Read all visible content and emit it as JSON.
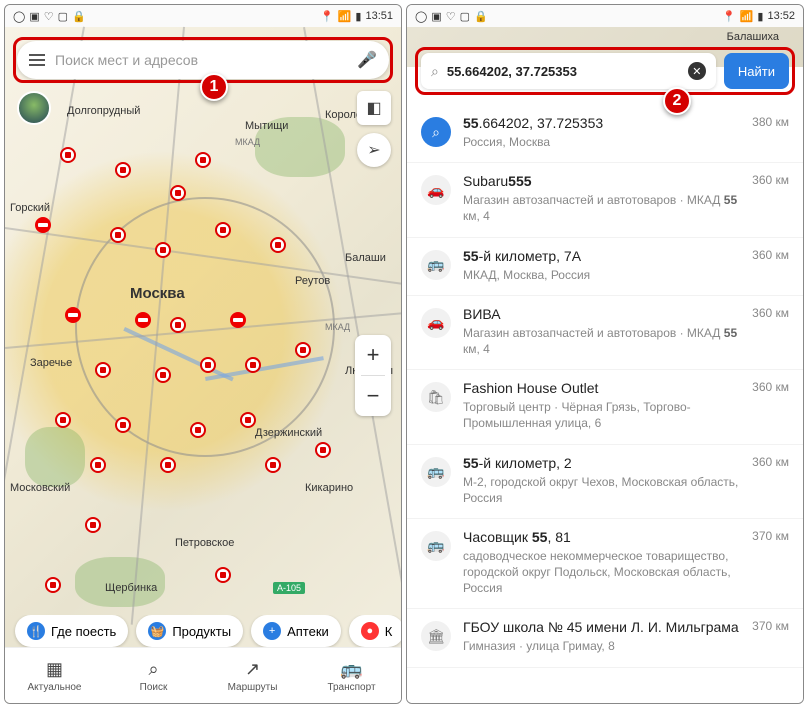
{
  "statusbar": {
    "time_left": "13:51",
    "time_right": "13:52"
  },
  "left": {
    "search_placeholder": "Поиск мест и адресов",
    "callout": "1",
    "labels": {
      "dolgoprudny": "Долгопрудный",
      "mytishchi": "Мытищи",
      "korolev": "Королёв",
      "moskva": "Москва",
      "reutov": "Реутов",
      "balashiha": "Балаши",
      "lyubertsy": "Люберцы",
      "dzerzhinsky": "Дзержинский",
      "moskovsky": "Московский",
      "zarechye": "Заречье",
      "kikarino": "Кикарино",
      "petrovskoe": "Петровское",
      "shcherbinka": "Щербинка",
      "ogorsky": "Горский",
      "mkad_n": "МКАД",
      "mkad_e": "МКАД",
      "a105": "А-105"
    },
    "chips": [
      {
        "icon": "🍴",
        "label": "Где поесть"
      },
      {
        "icon": "🧺",
        "label": "Продукты"
      },
      {
        "icon": "+",
        "label": "Аптеки"
      },
      {
        "icon": "●",
        "label": "К"
      }
    ],
    "nav": [
      {
        "icon": "▦",
        "label": "Актуальное"
      },
      {
        "icon": "⌕",
        "label": "Поиск"
      },
      {
        "icon": "↗",
        "label": "Маршруты"
      },
      {
        "icon": "🚌",
        "label": "Транспорт"
      }
    ]
  },
  "right": {
    "balashiha": "Балашиха",
    "search_value": "55.664202, 37.725353",
    "find_label": "Найти",
    "callout": "2",
    "results": [
      {
        "icon": "⌕",
        "primary": true,
        "title_bold": "55",
        "title_rest": ".664202, 37.725353",
        "sub": "Россия, Москва",
        "dist": "380 км"
      },
      {
        "icon": "🚗",
        "title_pre": "Subaru",
        "title_bold": "555",
        "sub_pre": "Магазин автозапчастей и автотоваров · МКАД ",
        "sub_bold": "55",
        "sub_post": " км, 4",
        "dist": "360 км"
      },
      {
        "icon": "🚌",
        "title_bold": "55",
        "title_rest": "-й километр, 7А",
        "sub": "МКАД, Москва, Россия",
        "dist": "360 км"
      },
      {
        "icon": "🚗",
        "title_plain": "ВИВА",
        "sub_pre": "Магазин автозапчастей и автотоваров · МКАД ",
        "sub_bold": "55",
        "sub_post": " км, 4",
        "dist": "360 км"
      },
      {
        "icon": "🛍",
        "title_plain": "Fashion House Outlet",
        "sub": "Торговый центр · Чёрная Грязь, Торгово-Промышленная улица, 6",
        "dist": "360 км"
      },
      {
        "icon": "🚌",
        "title_bold": "55",
        "title_rest": "-й километр, 2",
        "sub": "М-2, городской округ Чехов, Московская область, Россия",
        "dist": "360 км"
      },
      {
        "icon": "🚌",
        "title_pre": "Часовщик ",
        "title_bold": "55",
        "title_rest": ", 81",
        "sub": "садоводческое некоммерческое товарищество, городской округ Подольск, Московская область, Россия",
        "dist": "370 км"
      },
      {
        "icon": "🏛",
        "title_pre": "ГБОУ школа № 45 имени Л. И. Мильграма",
        "sub": "Гимназия · улица Гримау, 8",
        "dist": "370 км"
      }
    ]
  }
}
